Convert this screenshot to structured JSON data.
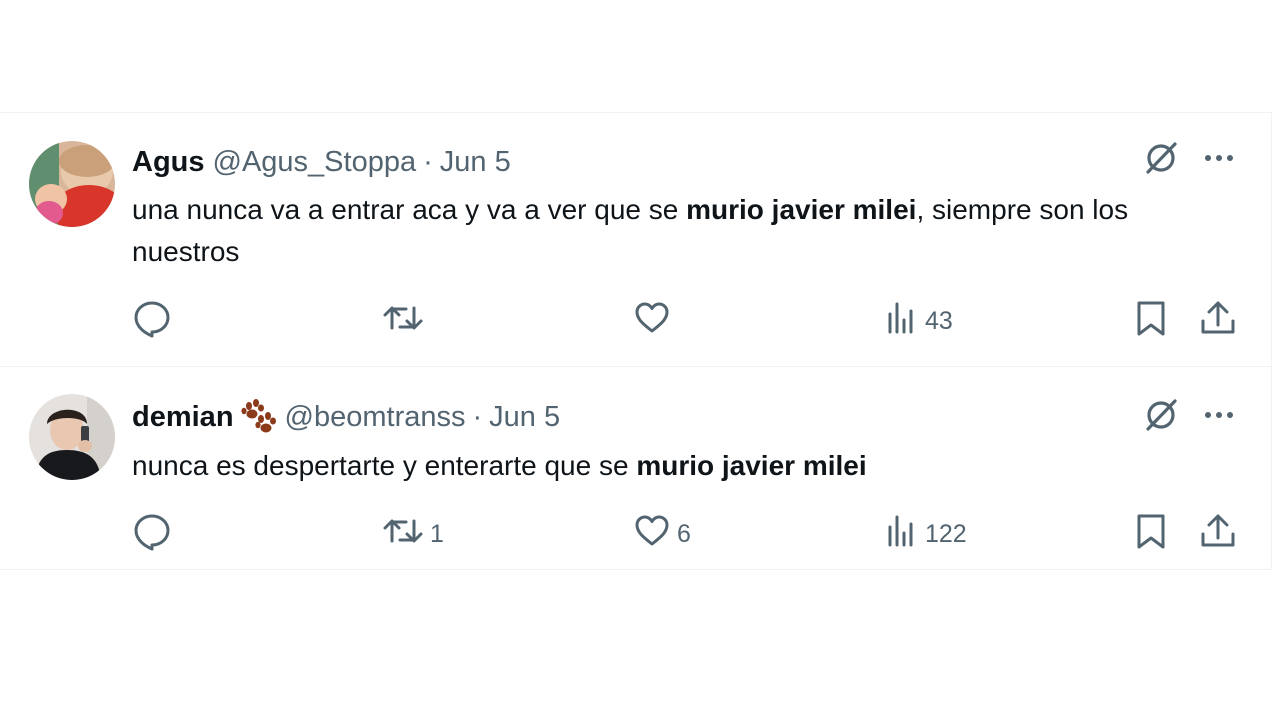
{
  "tweets": [
    {
      "display_name": "Agus",
      "handle": "@Agus_Stoppa",
      "separator": "·",
      "date": "Jun 5",
      "text_before": "una nunca va a entrar aca y va a ver que se ",
      "text_bold": "murio javier milei",
      "text_after": ", siempre son los nuestros",
      "replies": "",
      "retweets": "",
      "likes": "",
      "views": "43"
    },
    {
      "display_name": "demian",
      "handle": "@beomtranss",
      "separator": "·",
      "date": "Jun 5",
      "text_before": "nunca es despertarte y enterarte que se ",
      "text_bold": "murio javier milei",
      "text_after": "",
      "replies": "",
      "retweets": "1",
      "likes": "6",
      "views": "122"
    }
  ],
  "icons": {
    "reply": "reply-icon",
    "retweet": "retweet-icon",
    "like": "heart-icon",
    "views": "views-icon",
    "bookmark": "bookmark-icon",
    "share": "share-icon",
    "grok": "grok-icon",
    "more": "more-icon",
    "paw": "paw-emoji-icon"
  },
  "colors": {
    "text": "#0f1419",
    "secondary": "#536471",
    "divider": "#eff3f4",
    "paw": "#8b3a1a"
  }
}
